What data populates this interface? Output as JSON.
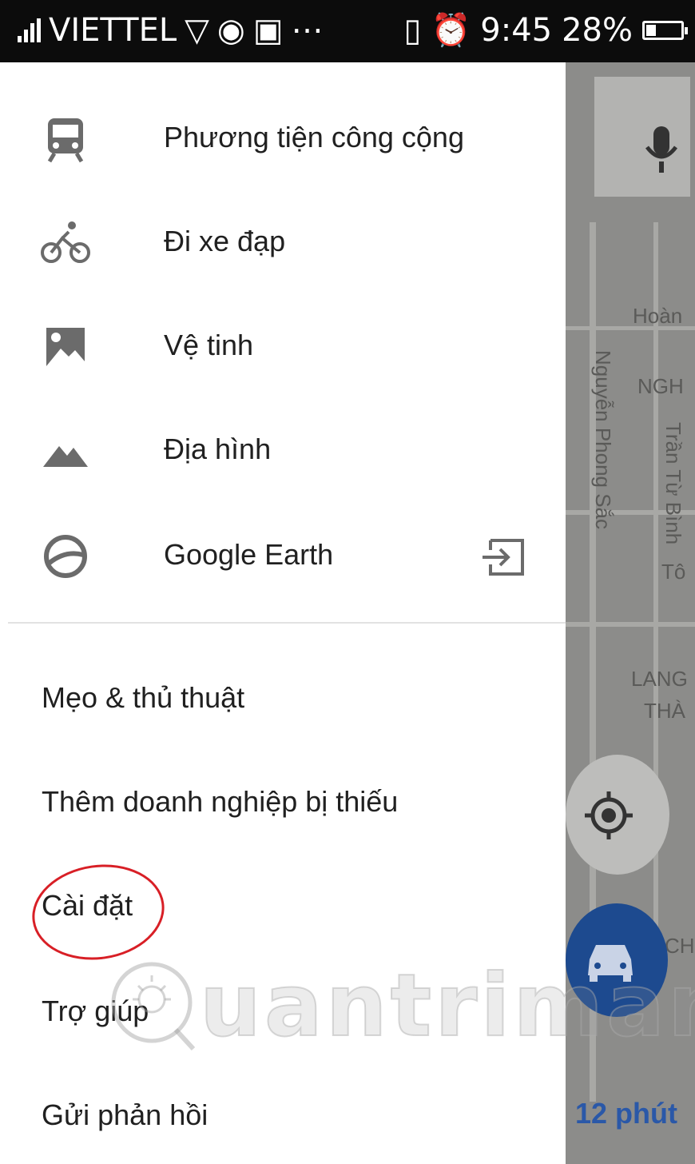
{
  "status_bar": {
    "carrier": "VIETTEL",
    "time": "9:45",
    "battery": "28%",
    "battery_level": 0.28
  },
  "drawer": {
    "layers": [
      {
        "label": "Phương tiện công cộng",
        "icon": "train-icon"
      },
      {
        "label": "Đi xe đạp",
        "icon": "bicycle-icon"
      },
      {
        "label": "Vệ tinh",
        "icon": "satellite-icon"
      },
      {
        "label": "Địa hình",
        "icon": "terrain-icon"
      },
      {
        "label": "Google Earth",
        "icon": "globe-icon",
        "trailing_icon": "open-external-icon"
      }
    ],
    "links": [
      {
        "label": "Mẹo & thủ thuật"
      },
      {
        "label": "Thêm doanh nghiệp bị thiếu"
      },
      {
        "label": "Cài đặt",
        "highlighted": true
      },
      {
        "label": "Trợ giúp"
      },
      {
        "label": "Gửi phản hồi"
      }
    ]
  },
  "map": {
    "labels": [
      "Hoàn",
      "NGH",
      "Nguyễn Phong Sắc",
      "Trần Từ Bình",
      "Tô",
      "LANG",
      "THÀ",
      "CH"
    ],
    "eta": "12 phút"
  },
  "watermark": "uantrimang",
  "colors": {
    "highlight_circle": "#d81f26",
    "directions_button": "#1d4a8f",
    "status_bar": "#0c0c0c"
  }
}
